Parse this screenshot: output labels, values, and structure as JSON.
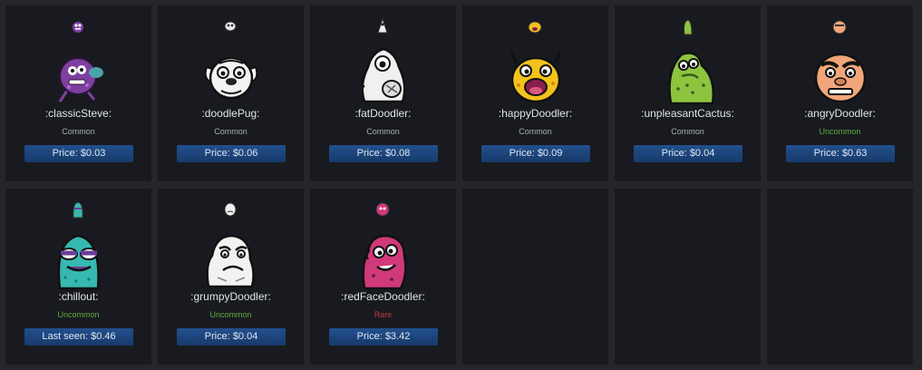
{
  "items": [
    {
      "name": ":classicSteve:",
      "rarity": "Common",
      "rarity_color": "#a9afb6",
      "price": "Price: $0.03",
      "icon": "classic-steve-emoticon-icon",
      "main_color": "#7f3fa0",
      "accent_color": "#4aa3a8"
    },
    {
      "name": ":doodlePug:",
      "rarity": "Common",
      "rarity_color": "#a9afb6",
      "price": "Price: $0.06",
      "icon": "doodle-pug-emoticon-icon",
      "main_color": "#f2f2f2",
      "accent_color": "#2b2b2b"
    },
    {
      "name": ":fatDoodler:",
      "rarity": "Common",
      "rarity_color": "#a9afb6",
      "price": "Price: $0.08",
      "icon": "fat-doodler-emoticon-icon",
      "main_color": "#f0f0f0",
      "accent_color": "#2b2b2b"
    },
    {
      "name": ":happyDoodler:",
      "rarity": "Common",
      "rarity_color": "#a9afb6",
      "price": "Price: $0.09",
      "icon": "happy-doodler-emoticon-icon",
      "main_color": "#f3c21b",
      "accent_color": "#8a1f4d"
    },
    {
      "name": ":unpleasantCactus:",
      "rarity": "Common",
      "rarity_color": "#a9afb6",
      "price": "Price: $0.04",
      "icon": "unpleasant-cactus-emoticon-icon",
      "main_color": "#8cc43f",
      "accent_color": "#3d5a20"
    },
    {
      "name": ":angryDoodler:",
      "rarity": "Uncommon",
      "rarity_color": "#5fae3b",
      "price": "Price: $0.63",
      "icon": "angry-doodler-emoticon-icon",
      "main_color": "#f0a67a",
      "accent_color": "#6b3a25"
    },
    {
      "name": ":chillout:",
      "rarity": "Uncommon",
      "rarity_color": "#5fae3b",
      "price": "Last seen: $0.46",
      "icon": "chillout-emoticon-icon",
      "main_color": "#36b9b0",
      "accent_color": "#6d3e9a"
    },
    {
      "name": ":grumpyDoodler:",
      "rarity": "Uncommon",
      "rarity_color": "#5fae3b",
      "price": "Price: $0.04",
      "icon": "grumpy-doodler-emoticon-icon",
      "main_color": "#f2f2f2",
      "accent_color": "#2b2b2b"
    },
    {
      "name": ":redFaceDoodler:",
      "rarity": "Rare",
      "rarity_color": "#c23b3b",
      "price": "Price: $3.42",
      "icon": "red-face-doodler-emoticon-icon",
      "main_color": "#d0397a",
      "accent_color": "#5a1a3a"
    },
    {
      "empty": true
    },
    {
      "empty": true
    },
    {
      "empty": true
    }
  ]
}
